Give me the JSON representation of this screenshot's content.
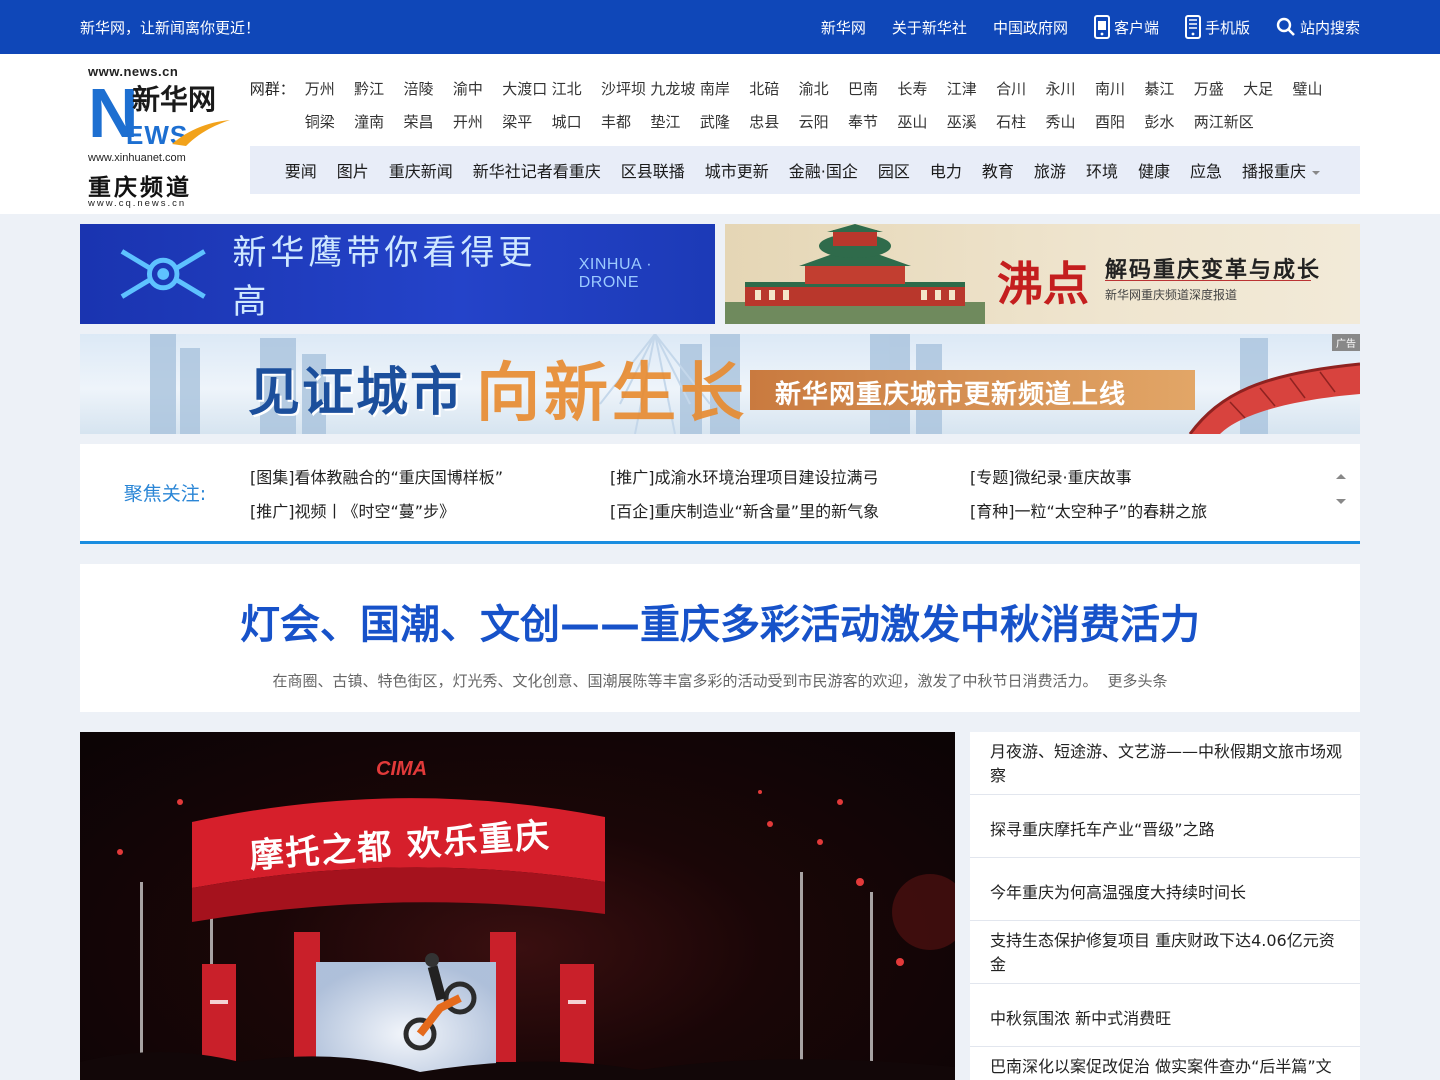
{
  "topbar": {
    "slogan": "新华网，让新闻离你更近！",
    "links": [
      {
        "label": "新华网"
      },
      {
        "label": "关于新华社"
      },
      {
        "label": "中国政府网"
      },
      {
        "label": "客户端",
        "icon": "phone-app-icon"
      },
      {
        "label": "手机版",
        "icon": "mobile-icon"
      },
      {
        "label": "站内搜索",
        "icon": "search-icon"
      }
    ]
  },
  "logo": {
    "url1": "www.news.cn",
    "brand": "新华网",
    "url2": "www.xinhuanet.com",
    "channel": "重庆频道",
    "url3": "www.cq.news.cn"
  },
  "netgroup": {
    "label": "网群：",
    "cities": [
      "万州",
      "黔江",
      "涪陵",
      "渝中",
      "大渡口",
      "江北",
      "沙坪坝",
      "九龙坡",
      "南岸",
      "北碚",
      "渝北",
      "巴南",
      "长寿",
      "江津",
      "合川",
      "永川",
      "南川",
      "綦江",
      "万盛",
      "大足",
      "璧山",
      "铜梁",
      "潼南",
      "荣昌",
      "开州",
      "梁平",
      "城口",
      "丰都",
      "垫江",
      "武隆",
      "忠县",
      "云阳",
      "奉节",
      "巫山",
      "巫溪",
      "石柱",
      "秀山",
      "酉阳",
      "彭水",
      "两江新区"
    ]
  },
  "nav": [
    "要闻",
    "图片",
    "重庆新闻",
    "新华社记者看重庆",
    "区县联播",
    "城市更新",
    "金融·国企",
    "园区",
    "电力",
    "教育",
    "旅游",
    "环境",
    "健康",
    "应急",
    "播报重庆"
  ],
  "banners": {
    "drone": {
      "text": "新华鹰带你看得更高",
      "en": "XINHUA · DRONE"
    },
    "fei": {
      "big": "沸点",
      "title": "解码重庆变革与成长",
      "sub": "新华网重庆频道深度报道"
    },
    "city": {
      "t1": "见证城市",
      "t2": "向新生长",
      "t3": "新华网重庆城市更新频道上线",
      "ad": "广告"
    }
  },
  "focus": {
    "label": "聚焦关注:",
    "items": [
      "[图集]看体教融合的“重庆国博样板”",
      "[推广]成渝水环境治理项目建设拉满弓",
      "[专题]微纪录·重庆故事",
      "[推广]视频丨《时空“蔓”步》",
      "[百企]重庆制造业“新含量”里的新气象",
      "[育种]一粒“太空种子”的春耕之旅"
    ]
  },
  "headline": {
    "title": "灯会、国潮、文创——重庆多彩活动激发中秋消费活力",
    "summary": "在商圈、古镇、特色街区，灯光秀、文化创意、国潮展陈等丰富多彩的活动受到市民游客的欢迎，激发了中秋节日消费活力。",
    "more": "更多头条"
  },
  "photo": {
    "sign": "摩托之都  欢乐重庆",
    "brand": "CIMA"
  },
  "news": [
    "月夜游、短途游、文艺游——中秋假期文旅市场观察",
    "探寻重庆摩托车产业“晋级”之路",
    "今年重庆为何高温强度大持续时间长",
    "支持生态保护修复项目 重庆财政下达4.06亿元资金",
    "中秋氛围浓 新中式消费旺",
    "巴南深化以案促改促治 做实案件查办“后半篇”文章"
  ],
  "colors": {
    "brand_blue": "#0f47b8",
    "headline_blue": "#1752c9",
    "focus_blue": "#2b86d6"
  }
}
